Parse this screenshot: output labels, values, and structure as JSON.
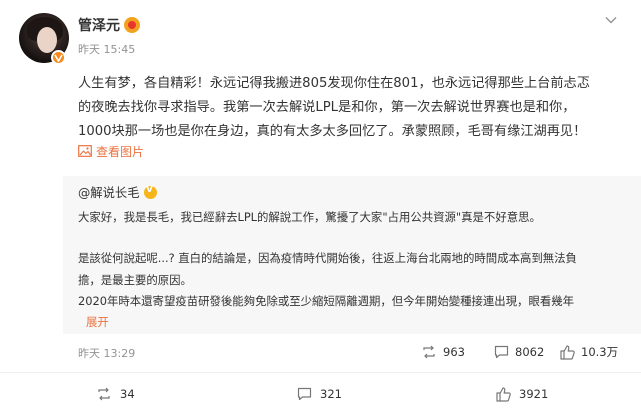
{
  "post": {
    "author": "管泽元",
    "timestamp": "昨天 15:45",
    "text_lines": [
      "人生有梦，各自精彩！永远记得我搬进805发现你住在801，也永远记得那些上台前忐忑",
      "的夜晚去找你寻求指导。我第一次去解说LPL是和你，第一次去解说世界赛也是和你，",
      "1000块那一场也是你在身边，真的有太多太多回忆了。承蒙照顾，毛哥有缘江湖再见！"
    ],
    "view_image_label": "查看图片"
  },
  "retweet": {
    "author": "@解说长毛",
    "lines": [
      "大家好，我是長毛，我已經辭去LPL的解說工作，驚擾了大家\"占用公共資源\"真是不好意思。",
      "是該從何說起呢...? 直白的結論是，因為疫情時代開始後，往返上海台北兩地的時間成本高到無法負",
      "擔，是最主要的原因。",
      "2020年時本還寄望疫苗研發後能夠免除或至少縮短隔離週期，但今年開始變種接連出現，眼看幾年"
    ],
    "expand_label": "展开",
    "timestamp": "昨天 13:29",
    "stats": {
      "reposts": "963",
      "comments": "8062",
      "likes": "10.3万"
    }
  },
  "main_stats": {
    "reposts": "34",
    "comments": "321",
    "likes": "3921"
  },
  "colors": {
    "accent": "#eb7340",
    "muted": "#939393",
    "quote_bg": "#f7f7f7"
  }
}
